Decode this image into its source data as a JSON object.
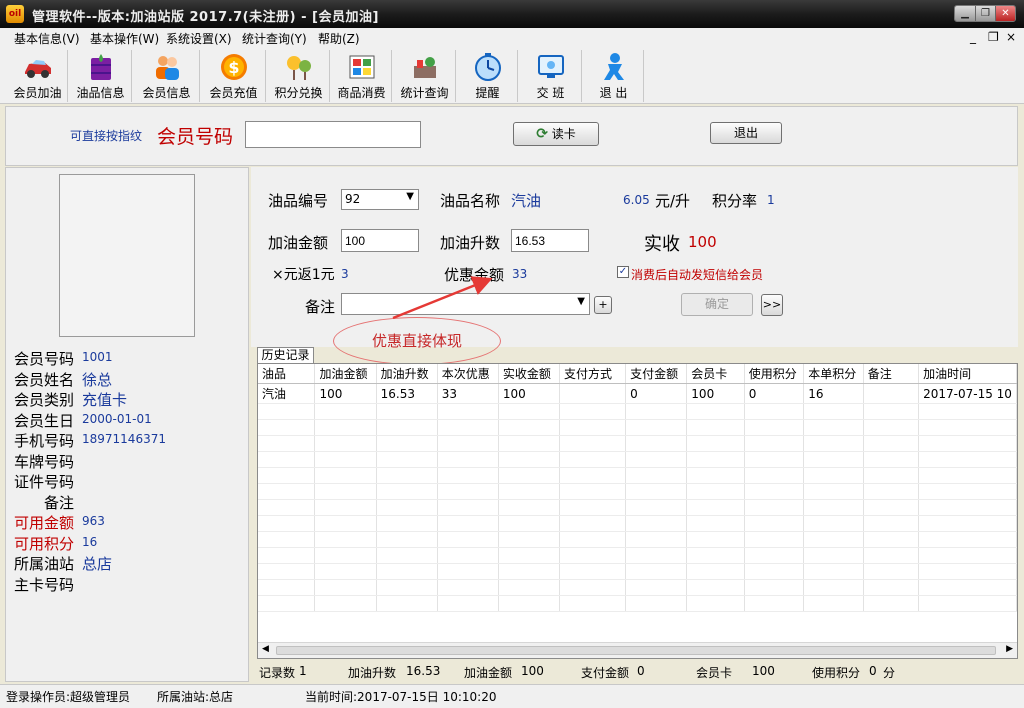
{
  "window": {
    "icon_text": "oil",
    "title": "管理软件--版本:加油站版  2017.7(未注册) - [会员加油]",
    "controls": [
      "▁",
      "❐",
      "✕"
    ]
  },
  "menu": {
    "items": [
      "基本信息(V)",
      "基本操作(W)",
      "系统设置(X)",
      "统计查询(Y)",
      "帮助(Z)"
    ],
    "mdi_controls": [
      "_",
      "❐",
      "×"
    ]
  },
  "toolbar": {
    "buttons": [
      {
        "label": "会员加油",
        "icon": "car-icon"
      },
      {
        "label": "油品信息",
        "icon": "oil-drum-icon"
      },
      {
        "label": "会员信息",
        "icon": "users-icon"
      },
      {
        "label": "会员充值",
        "icon": "coin-icon"
      },
      {
        "label": "积分兑换",
        "icon": "gift-icon"
      },
      {
        "label": "商品消费",
        "icon": "grid-icon"
      },
      {
        "label": "统计查询",
        "icon": "stats-icon"
      },
      {
        "label": "提醒",
        "icon": "clock-icon"
      },
      {
        "label": "交 班",
        "icon": "monitor-icon"
      },
      {
        "label": "退 出",
        "icon": "exit-person-icon"
      }
    ]
  },
  "top_panel": {
    "hint": "可直接按指纹",
    "member_no_label": "会员号码",
    "member_no_value": "",
    "read_card": "读卡",
    "exit": "退出"
  },
  "member": {
    "fields": [
      {
        "label": "会员号码",
        "value": "1001",
        "style": "small"
      },
      {
        "label": "会员姓名",
        "value": "徐总",
        "style": "big"
      },
      {
        "label": "会员类别",
        "value": "充值卡",
        "style": "big"
      },
      {
        "label": "会员生日",
        "value": "2000-01-01",
        "style": "small"
      },
      {
        "label": "手机号码",
        "value": "18971146371",
        "style": "small"
      },
      {
        "label": "车牌号码",
        "value": "",
        "style": "small"
      },
      {
        "label": "证件号码",
        "value": "",
        "style": "small"
      },
      {
        "label": "备注",
        "value": "",
        "style": "small"
      },
      {
        "label": "可用金额",
        "value": "963",
        "style": "small",
        "red": true
      },
      {
        "label": "可用积分",
        "value": "16",
        "style": "small",
        "red": true
      },
      {
        "label": "所属油站",
        "value": "总店",
        "style": "big"
      },
      {
        "label": "主卡号码",
        "value": "",
        "style": "small"
      }
    ]
  },
  "form": {
    "oil_code_label": "油品编号",
    "oil_code_value": "92",
    "oil_name_label": "油品名称",
    "oil_name_value": "汽油",
    "price_value": "6.05",
    "price_unit": "元/升",
    "points_rate_label": "积分率",
    "points_rate_value": "1",
    "amount_label": "加油金额",
    "amount_value": "100",
    "liters_label": "加油升数",
    "liters_value": "16.53",
    "actual_label": "实收",
    "actual_value": "100",
    "rebate_label": "×元返1元",
    "rebate_value": "3",
    "discount_label": "优惠金额",
    "discount_value": "33",
    "sms_label": "消费后自动发短信给会员",
    "sms_checked": true,
    "note_label": "备注",
    "note_value": "",
    "plus_label": "+",
    "confirm_label": "确定",
    "more_label": ">>"
  },
  "annotation": {
    "text": "优惠直接体现"
  },
  "history": {
    "tab_label": "历史记录",
    "columns": [
      "油品",
      "加油金额",
      "加油升数",
      "本次优惠",
      "实收金额",
      "支付方式",
      "支付金额",
      "会员卡",
      "使用积分",
      "本单积分",
      "备注",
      "加油时间"
    ],
    "rows": [
      [
        "汽油",
        "100",
        "16.53",
        "33",
        "100",
        "",
        "0",
        "100",
        "0",
        "16",
        "",
        "2017-07-15 10"
      ]
    ]
  },
  "grid_status": {
    "count_label": "记录数",
    "count_value": "1",
    "liters_label": "加油升数",
    "liters_value": "16.53",
    "amount_label": "加油金额",
    "amount_value": "100",
    "pay_label": "支付金额",
    "pay_value": "0",
    "card_label": "会员卡",
    "card_value": "100",
    "points_label": "使用积分",
    "points_value": "0",
    "points_unit": "分"
  },
  "status": {
    "operator": "登录操作员:超级管理员",
    "station": "所属油站:总店",
    "time": "当前时间:2017-07-15日  10:10:20"
  },
  "colors": {
    "label_red": "#c00000",
    "value_blue": "#1a3a9c",
    "annotation_arrow": "#e53935"
  }
}
